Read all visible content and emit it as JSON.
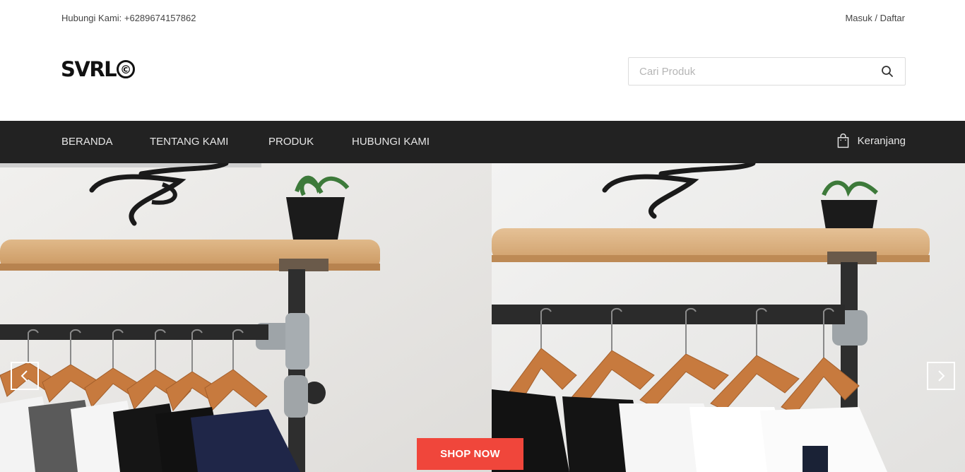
{
  "topbar": {
    "contact": "Hubungi Kami: +6289674157862",
    "login": "Masuk",
    "separator": " / ",
    "register": "Daftar"
  },
  "logo": {
    "text": "SVRL",
    "mark": "©"
  },
  "search": {
    "placeholder": "Cari Produk",
    "icon": "search-icon"
  },
  "nav": {
    "items": [
      {
        "label": "BERANDA"
      },
      {
        "label": "TENTANG KAMI"
      },
      {
        "label": "PRODUK"
      },
      {
        "label": "HUBUNGI KAMI"
      }
    ],
    "cart_label": "Keranjang",
    "cart_icon": "shopping-bag-icon",
    "background": "#222222"
  },
  "hero": {
    "cta_label": "SHOP NOW",
    "cta_color": "#f0463b",
    "prev_icon": "chevron-left-icon",
    "next_icon": "chevron-right-icon"
  }
}
